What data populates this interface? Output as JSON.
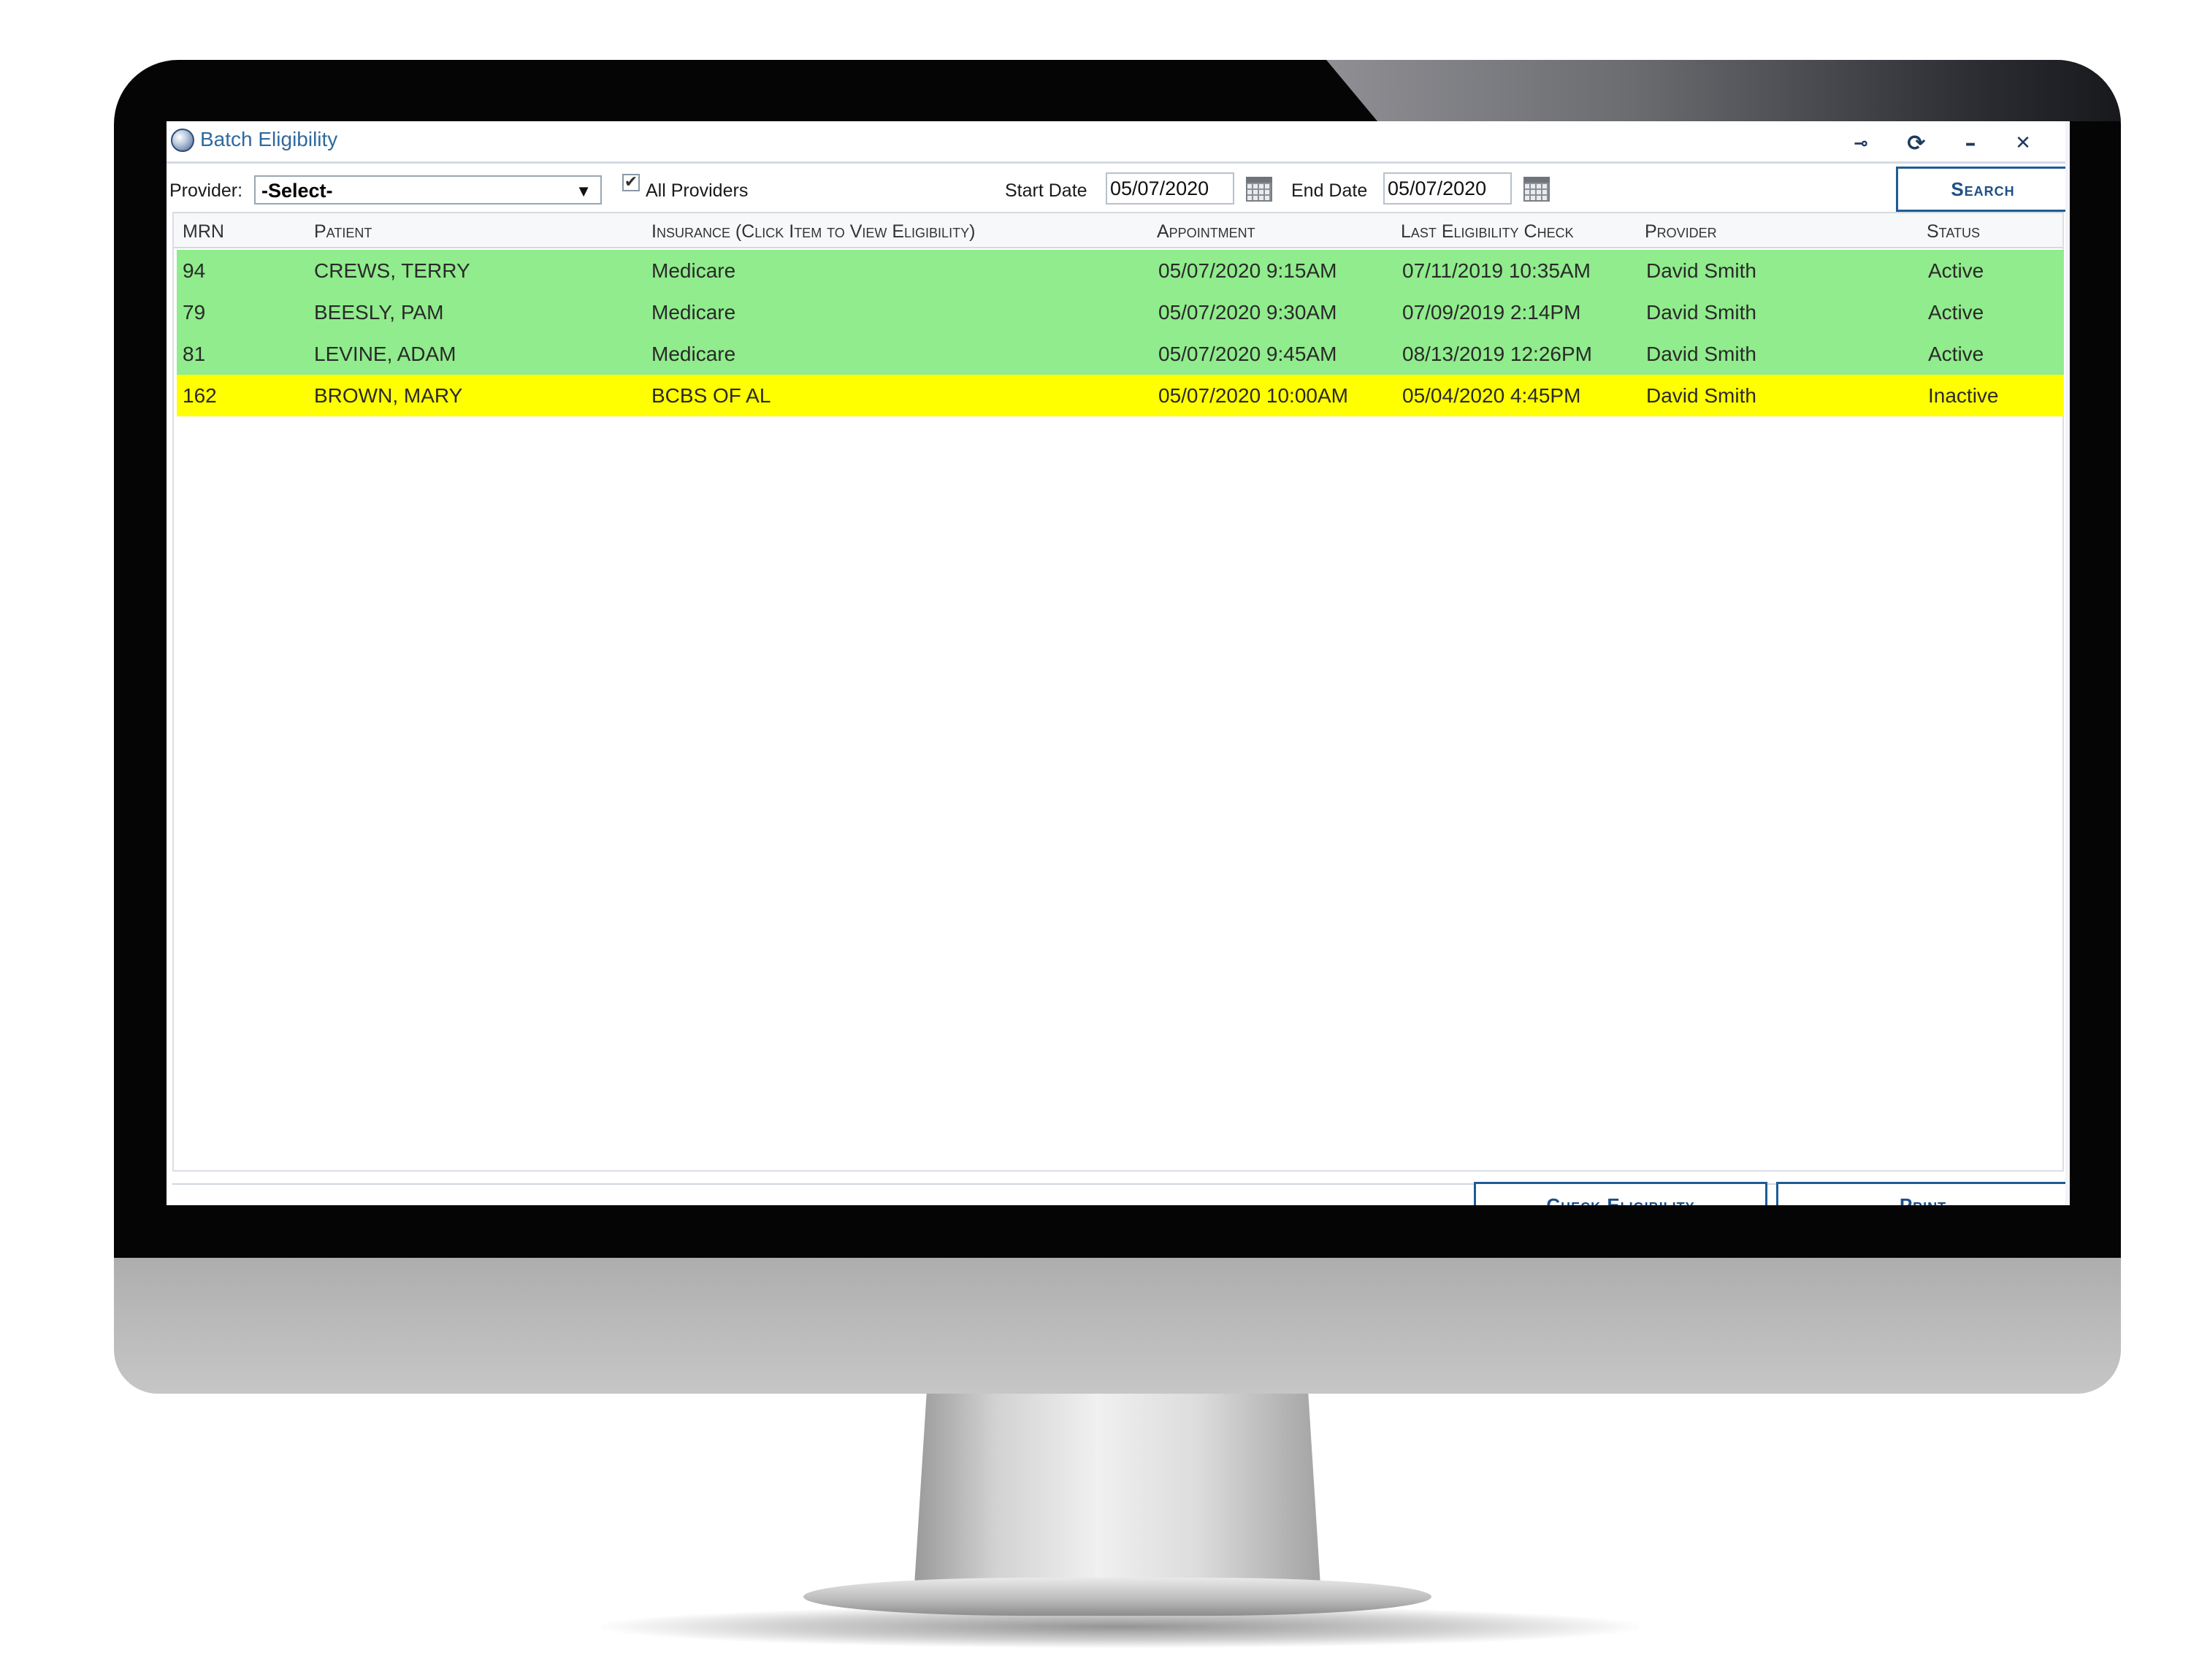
{
  "window": {
    "title": "Batch Eligibility",
    "controls": {
      "pin": "⊸",
      "refresh": "⟳",
      "minimize": "–",
      "close": "✕"
    }
  },
  "toolbar": {
    "provider_label": "Provider:",
    "provider_value": "-Select-",
    "provider_arrow": "▼",
    "all_providers_checked": "✔",
    "all_providers_label": "All Providers",
    "start_date_label": "Start Date",
    "start_date_value": "05/07/2020",
    "end_date_label": "End Date",
    "end_date_value": "05/07/2020",
    "search_label": "Search"
  },
  "grid": {
    "columns": [
      "MRN",
      "Patient",
      "Insurance (Click Item to View Eligibility)",
      "Appointment",
      "Last Eligibility Check",
      "Provider",
      "Status"
    ],
    "rows": [
      {
        "mrn": "94",
        "patient": "CREWS, TERRY",
        "insurance": "Medicare",
        "appointment": "05/07/2020 9:15AM",
        "last_check": "07/11/2019 10:35AM",
        "provider": "David Smith",
        "status": "Active"
      },
      {
        "mrn": "79",
        "patient": "BEESLY, PAM",
        "insurance": "Medicare",
        "appointment": "05/07/2020 9:30AM",
        "last_check": "07/09/2019 2:14PM",
        "provider": "David Smith",
        "status": "Active"
      },
      {
        "mrn": "81",
        "patient": "LEVINE, ADAM",
        "insurance": "Medicare",
        "appointment": "05/07/2020 9:45AM",
        "last_check": "08/13/2019 12:26PM",
        "provider": "David Smith",
        "status": "Active"
      },
      {
        "mrn": "162",
        "patient": "BROWN, MARY",
        "insurance": "BCBS OF AL",
        "appointment": "05/07/2020 10:00AM",
        "last_check": "05/04/2020 4:45PM",
        "provider": "David Smith",
        "status": "Inactive"
      }
    ]
  },
  "footer": {
    "check_eligibility_label": "Check Eligibility",
    "print_label": "Print"
  },
  "colors": {
    "active_row": "#90ec8c",
    "inactive_row": "#ffff00",
    "accent": "#1e5c96"
  }
}
